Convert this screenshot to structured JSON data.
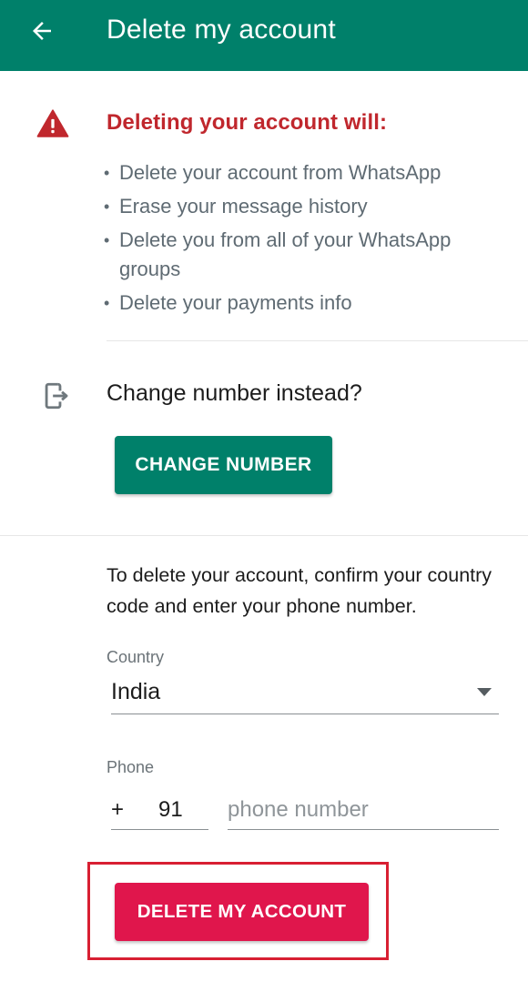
{
  "app_bar": {
    "title": "Delete my account",
    "background_color": "#00806A",
    "back_icon": "arrow-left-icon"
  },
  "warning": {
    "icon": "warning-triangle-icon",
    "heading": "Deleting your account will:",
    "heading_color": "#C0272D",
    "items": [
      "Delete your account from WhatsApp",
      "Erase your message history",
      "Delete you from all of your WhatsApp groups",
      "Delete your payments info"
    ]
  },
  "change_number": {
    "icon": "change-phone-icon",
    "label": "Change number instead?",
    "button_label": "CHANGE NUMBER",
    "button_color": "#00806A"
  },
  "confirm_form": {
    "instructions": "To delete your account, confirm your country code and enter your phone number.",
    "country_label": "Country",
    "country_value": "India",
    "phone_label": "Phone",
    "country_code_prefix": "+",
    "country_code": "91",
    "phone_placeholder": "phone number",
    "phone_value": ""
  },
  "delete_button": {
    "label": "DELETE MY ACCOUNT",
    "color": "#E0164C",
    "highlight_color": "#D81F32"
  }
}
